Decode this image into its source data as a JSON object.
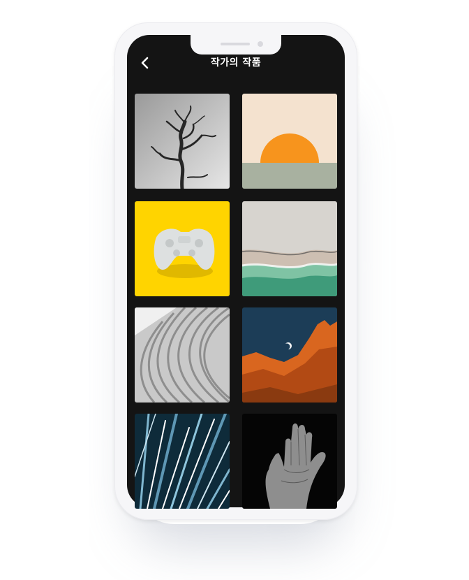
{
  "header": {
    "title": "작가의 작품",
    "back_icon": "chevron-left-icon"
  },
  "gallery": {
    "items": [
      {
        "subject": "bare-tree"
      },
      {
        "subject": "sunset"
      },
      {
        "subject": "game-controller"
      },
      {
        "subject": "beach-aerial"
      },
      {
        "subject": "curved-architecture"
      },
      {
        "subject": "red-rock-moon"
      },
      {
        "subject": "light-streaks"
      },
      {
        "subject": "hand"
      }
    ]
  },
  "colors": {
    "screen_bg": "#141414",
    "title_text": "#ffffff",
    "frame": "#f6f6f8"
  }
}
